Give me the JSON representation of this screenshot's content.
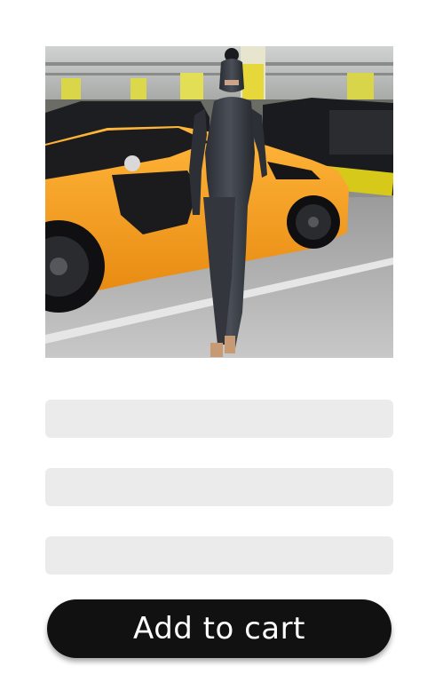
{
  "product": {
    "image_icon": "product-photo-image"
  },
  "placeholders": [
    {
      "kind": "loading-field"
    },
    {
      "kind": "loading-field"
    },
    {
      "kind": "loading-field"
    }
  ],
  "cart": {
    "add_label": "Add to cart"
  },
  "colors": {
    "button_bg": "#111111",
    "button_text": "#ffffff",
    "skeleton": "#ebebeb",
    "car_accent": "#f39a1c"
  }
}
